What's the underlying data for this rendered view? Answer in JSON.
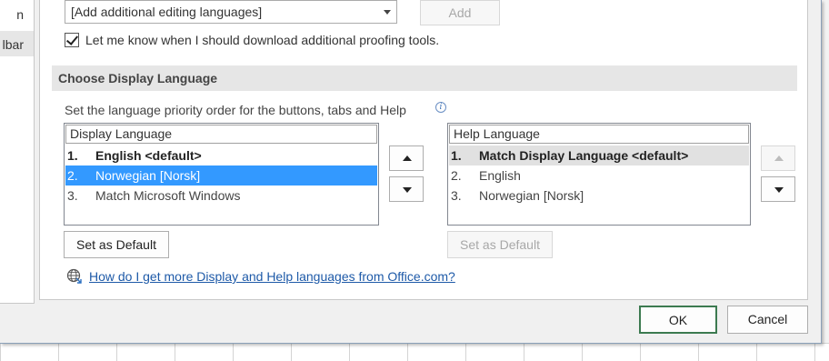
{
  "left_nav": {
    "items": [
      {
        "label": "n"
      },
      {
        "label": "lbar"
      }
    ]
  },
  "editing": {
    "combo_value": "[Add additional editing languages]",
    "add_label": "Add",
    "proofing_checkbox_label": "Let me know when I should download additional proofing tools.",
    "proofing_checked": true
  },
  "display_section": {
    "header": "Choose Display Language",
    "priority_text": "Set the language priority order for the buttons, tabs and Help",
    "display_list": {
      "header": "Display Language",
      "rows": [
        {
          "num": "1.",
          "name": "English <default>"
        },
        {
          "num": "2.",
          "name": "Norwegian [Norsk]"
        },
        {
          "num": "3.",
          "name": "Match Microsoft Windows"
        }
      ]
    },
    "help_list": {
      "header": "Help Language",
      "rows": [
        {
          "num": "1.",
          "name": "Match Display Language <default>"
        },
        {
          "num": "2.",
          "name": "English"
        },
        {
          "num": "3.",
          "name": "Norwegian [Norsk]"
        }
      ]
    },
    "set_default_label": "Set as Default",
    "help_link": "How do I get more Display and Help languages from Office.com?"
  },
  "footer": {
    "ok_label": "OK",
    "cancel_label": "Cancel"
  },
  "colors": {
    "selection": "#3399ff",
    "link": "#1e5aa8",
    "ok_border": "#3c7a50"
  }
}
